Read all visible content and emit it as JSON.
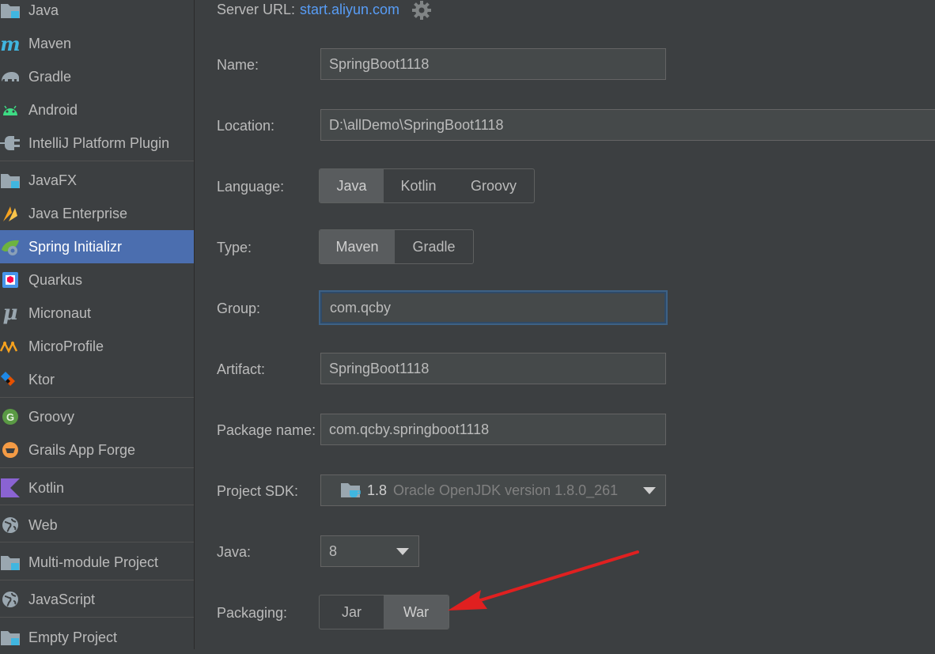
{
  "sidebar": {
    "items": [
      {
        "label": "Java",
        "icon": "folder-icon"
      },
      {
        "label": "Maven",
        "icon": "maven-icon"
      },
      {
        "label": "Gradle",
        "icon": "gradle-elephant-icon"
      },
      {
        "label": "Android",
        "icon": "android-icon"
      },
      {
        "label": "IntelliJ Platform Plugin",
        "icon": "plugin-icon"
      },
      {
        "label": "JavaFX",
        "icon": "folder-icon"
      },
      {
        "label": "Java Enterprise",
        "icon": "java-enterprise-icon"
      },
      {
        "label": "Spring Initializr",
        "icon": "spring-initializr-icon",
        "selected": true
      },
      {
        "label": "Quarkus",
        "icon": "quarkus-icon"
      },
      {
        "label": "Micronaut",
        "icon": "micronaut-icon"
      },
      {
        "label": "MicroProfile",
        "icon": "microprofile-icon"
      },
      {
        "label": "Ktor",
        "icon": "ktor-icon"
      },
      {
        "label": "Groovy",
        "icon": "groovy-icon"
      },
      {
        "label": "Grails App Forge",
        "icon": "grails-icon"
      },
      {
        "label": "Kotlin",
        "icon": "kotlin-icon"
      },
      {
        "label": "Web",
        "icon": "globe-icon"
      },
      {
        "label": "Multi-module Project",
        "icon": "folder-icon"
      },
      {
        "label": "JavaScript",
        "icon": "globe-icon"
      },
      {
        "label": "Empty Project",
        "icon": "folder-icon"
      }
    ]
  },
  "form": {
    "server_url_label": "Server URL:",
    "server_url": "start.aliyun.com",
    "name_label": "Name:",
    "name_value": "SpringBoot1118",
    "location_label": "Location:",
    "location_value": "D:\\allDemo\\SpringBoot1118",
    "language_label": "Language:",
    "language_options": [
      "Java",
      "Kotlin",
      "Groovy"
    ],
    "language_selected": "Java",
    "type_label": "Type:",
    "type_options": [
      "Maven",
      "Gradle"
    ],
    "type_selected": "Maven",
    "group_label": "Group:",
    "group_value": "com.qcby",
    "artifact_label": "Artifact:",
    "artifact_value": "SpringBoot1118",
    "package_label": "Package name:",
    "package_value": "com.qcby.springboot1118",
    "sdk_label": "Project SDK:",
    "sdk_version": "1.8",
    "sdk_desc": "Oracle OpenJDK version 1.8.0_261",
    "java_label": "Java:",
    "java_value": "8",
    "packaging_label": "Packaging:",
    "packaging_options": [
      "Jar",
      "War"
    ],
    "packaging_selected": "War"
  },
  "colors": {
    "background": "#3c3f41",
    "selection": "#4b6eaf",
    "link": "#589df6",
    "annotation_arrow": "#e02020"
  }
}
